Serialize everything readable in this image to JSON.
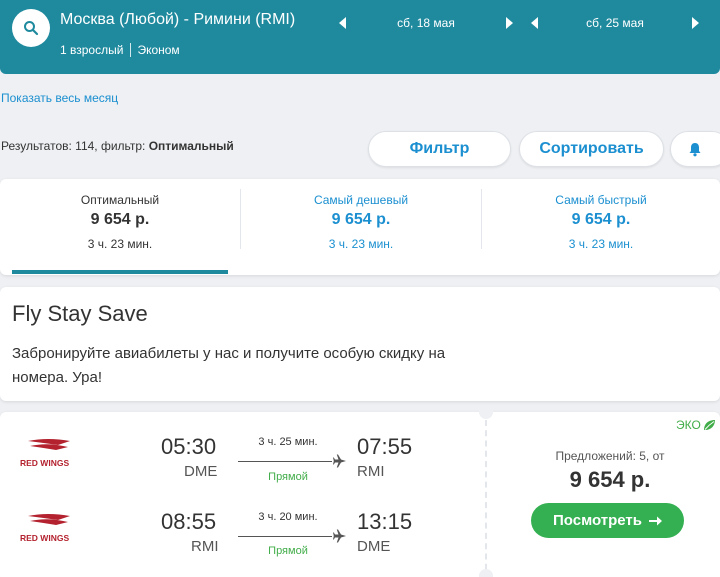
{
  "header": {
    "route": "Москва (Любой) - Римини (RMI)",
    "passengers": "1 взрослый",
    "cabin": "Эконом",
    "depart_date": "сб, 18 мая",
    "return_date": "сб, 25 мая",
    "background_color": "#1f8a9e"
  },
  "month_link": "Показать весь месяц",
  "results": {
    "prefix": "Результатов: 114, фильтр: ",
    "filter_value": "Оптимальный"
  },
  "toolbar": {
    "filter_label": "Фильтр",
    "sort_label": "Сортировать",
    "alert_icon": "bell-icon"
  },
  "sort_tabs": [
    {
      "title": "Оптимальный",
      "price": "9 654 р.",
      "duration": "3 ч. 23 мин.",
      "active": true
    },
    {
      "title": "Самый дешевый",
      "price": "9 654 р.",
      "duration": "3 ч. 23 мин.",
      "active": false
    },
    {
      "title": "Самый быстрый",
      "price": "9 654 р.",
      "duration": "3 ч. 23 мин.",
      "active": false
    }
  ],
  "promo": {
    "title": "Fly Stay Save",
    "text": "Забронируйте авиабилеты у нас и получите особую скидку на номера. Ура!"
  },
  "ticket": {
    "eco_label": "ЭКО",
    "offers": "Предложений: 5, от",
    "price": "9 654 р.",
    "button_label": "Посмотреть",
    "segments": [
      {
        "airline": "RED WINGS",
        "dep_time": "05:30",
        "dep_code": "DME",
        "duration": "3 ч. 25 мин.",
        "type": "Прямой",
        "arr_time": "07:55",
        "arr_code": "RMI"
      },
      {
        "airline": "RED WINGS",
        "dep_time": "08:55",
        "dep_code": "RMI",
        "duration": "3 ч. 20 мин.",
        "type": "Прямой",
        "arr_time": "13:15",
        "arr_code": "DME"
      }
    ]
  },
  "colors": {
    "accent": "#1f8a9e",
    "link": "#1b8fd0",
    "green": "#41ad49",
    "button": "#34b052"
  }
}
